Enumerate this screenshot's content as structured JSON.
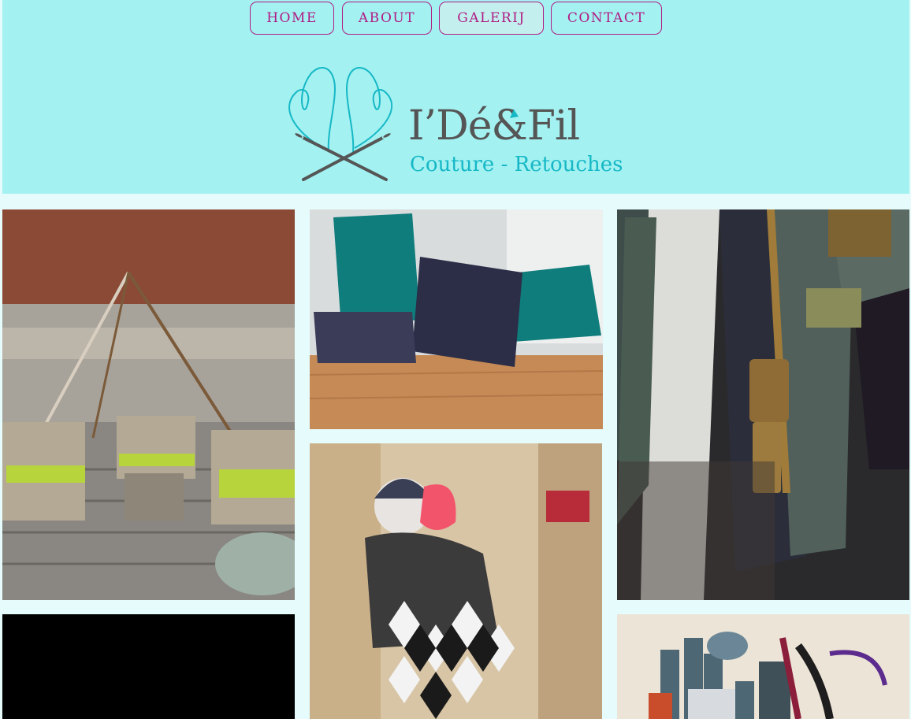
{
  "nav": {
    "items": [
      {
        "label": "HOME"
      },
      {
        "label": "ABOUT"
      },
      {
        "label": "GALERIJ"
      },
      {
        "label": "CONTACT"
      }
    ]
  },
  "logo": {
    "title": "I’Dé&Fil",
    "subtitle": "Couture - Retouches"
  },
  "gallery": {
    "images": [
      {
        "icon": "garden-terrace-photo"
      },
      {
        "icon": "cushions-photo"
      },
      {
        "icon": "zippers-photo"
      },
      {
        "icon": "black-video-photo"
      },
      {
        "icon": "harlequin-costume-photo"
      },
      {
        "icon": "sewing-supplies-photo"
      }
    ]
  },
  "colors": {
    "header_bg": "#a3f1f1",
    "accent": "#b01c84",
    "logo_teal": "#16b8c6"
  }
}
